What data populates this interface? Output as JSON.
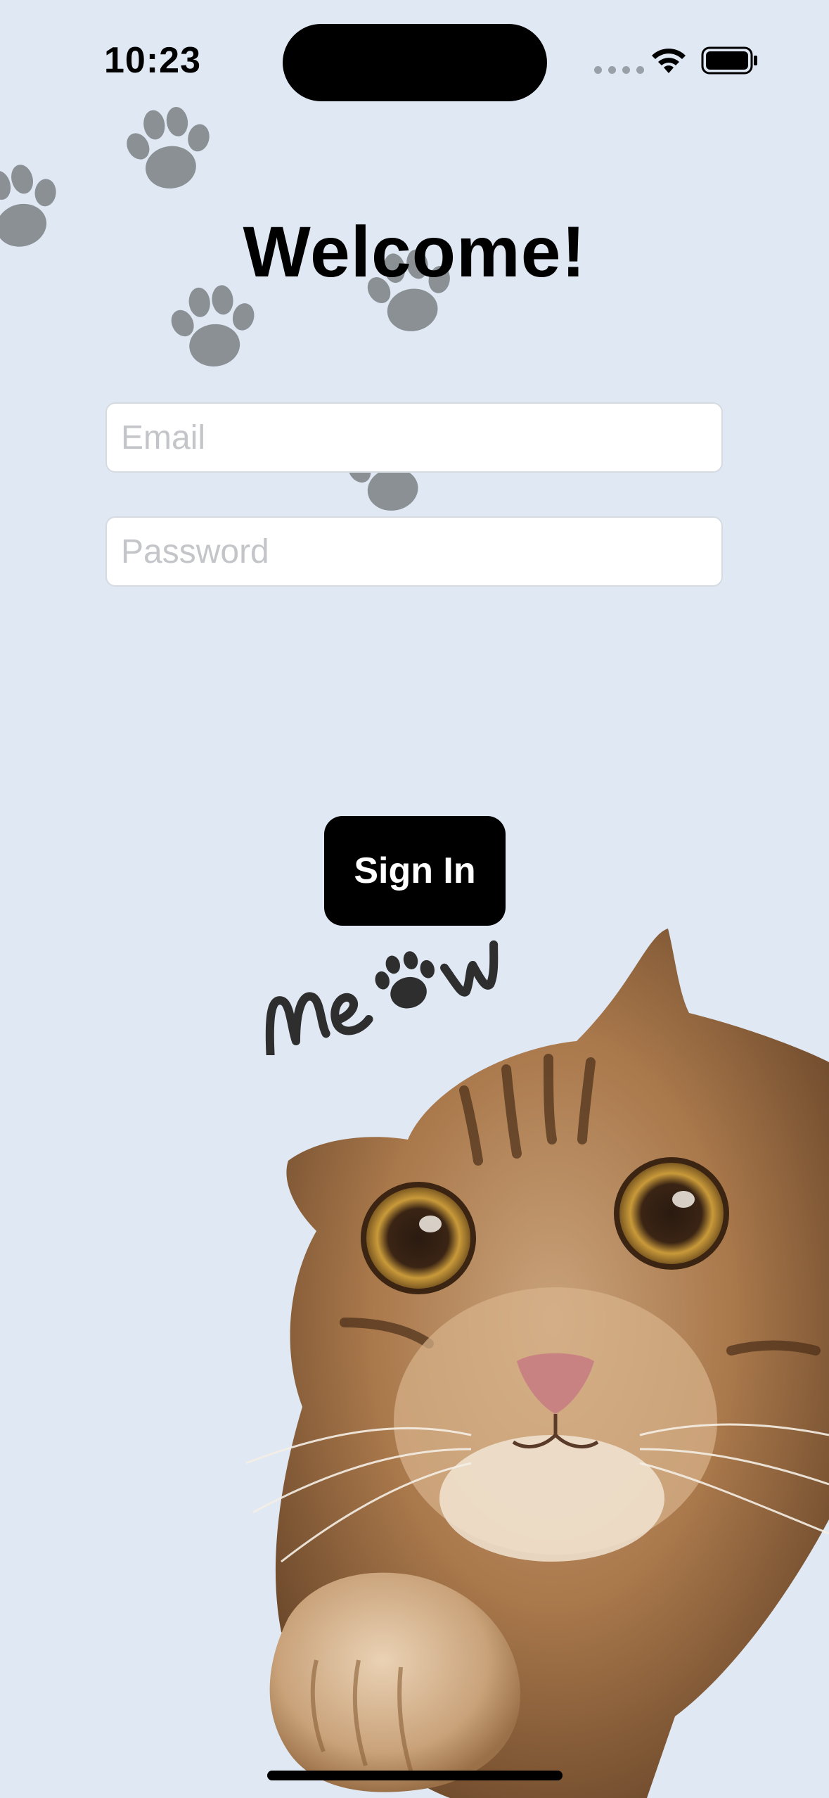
{
  "status_bar": {
    "time": "10:23",
    "wifi_icon": "wifi-icon",
    "battery_icon": "battery-icon"
  },
  "header": {
    "title": "Welcome!"
  },
  "form": {
    "email_placeholder": "Email",
    "email_value": "",
    "password_placeholder": "Password",
    "password_value": ""
  },
  "actions": {
    "sign_in_label": "Sign In"
  },
  "decorations": {
    "background_icon": "paw-print-icon",
    "illustration": "cat-peeking-illustration",
    "logo_text": "Meow"
  },
  "colors": {
    "background": "#dfe8f3",
    "paw": "#8b9095",
    "button": "#000000",
    "button_text": "#ffffff"
  }
}
